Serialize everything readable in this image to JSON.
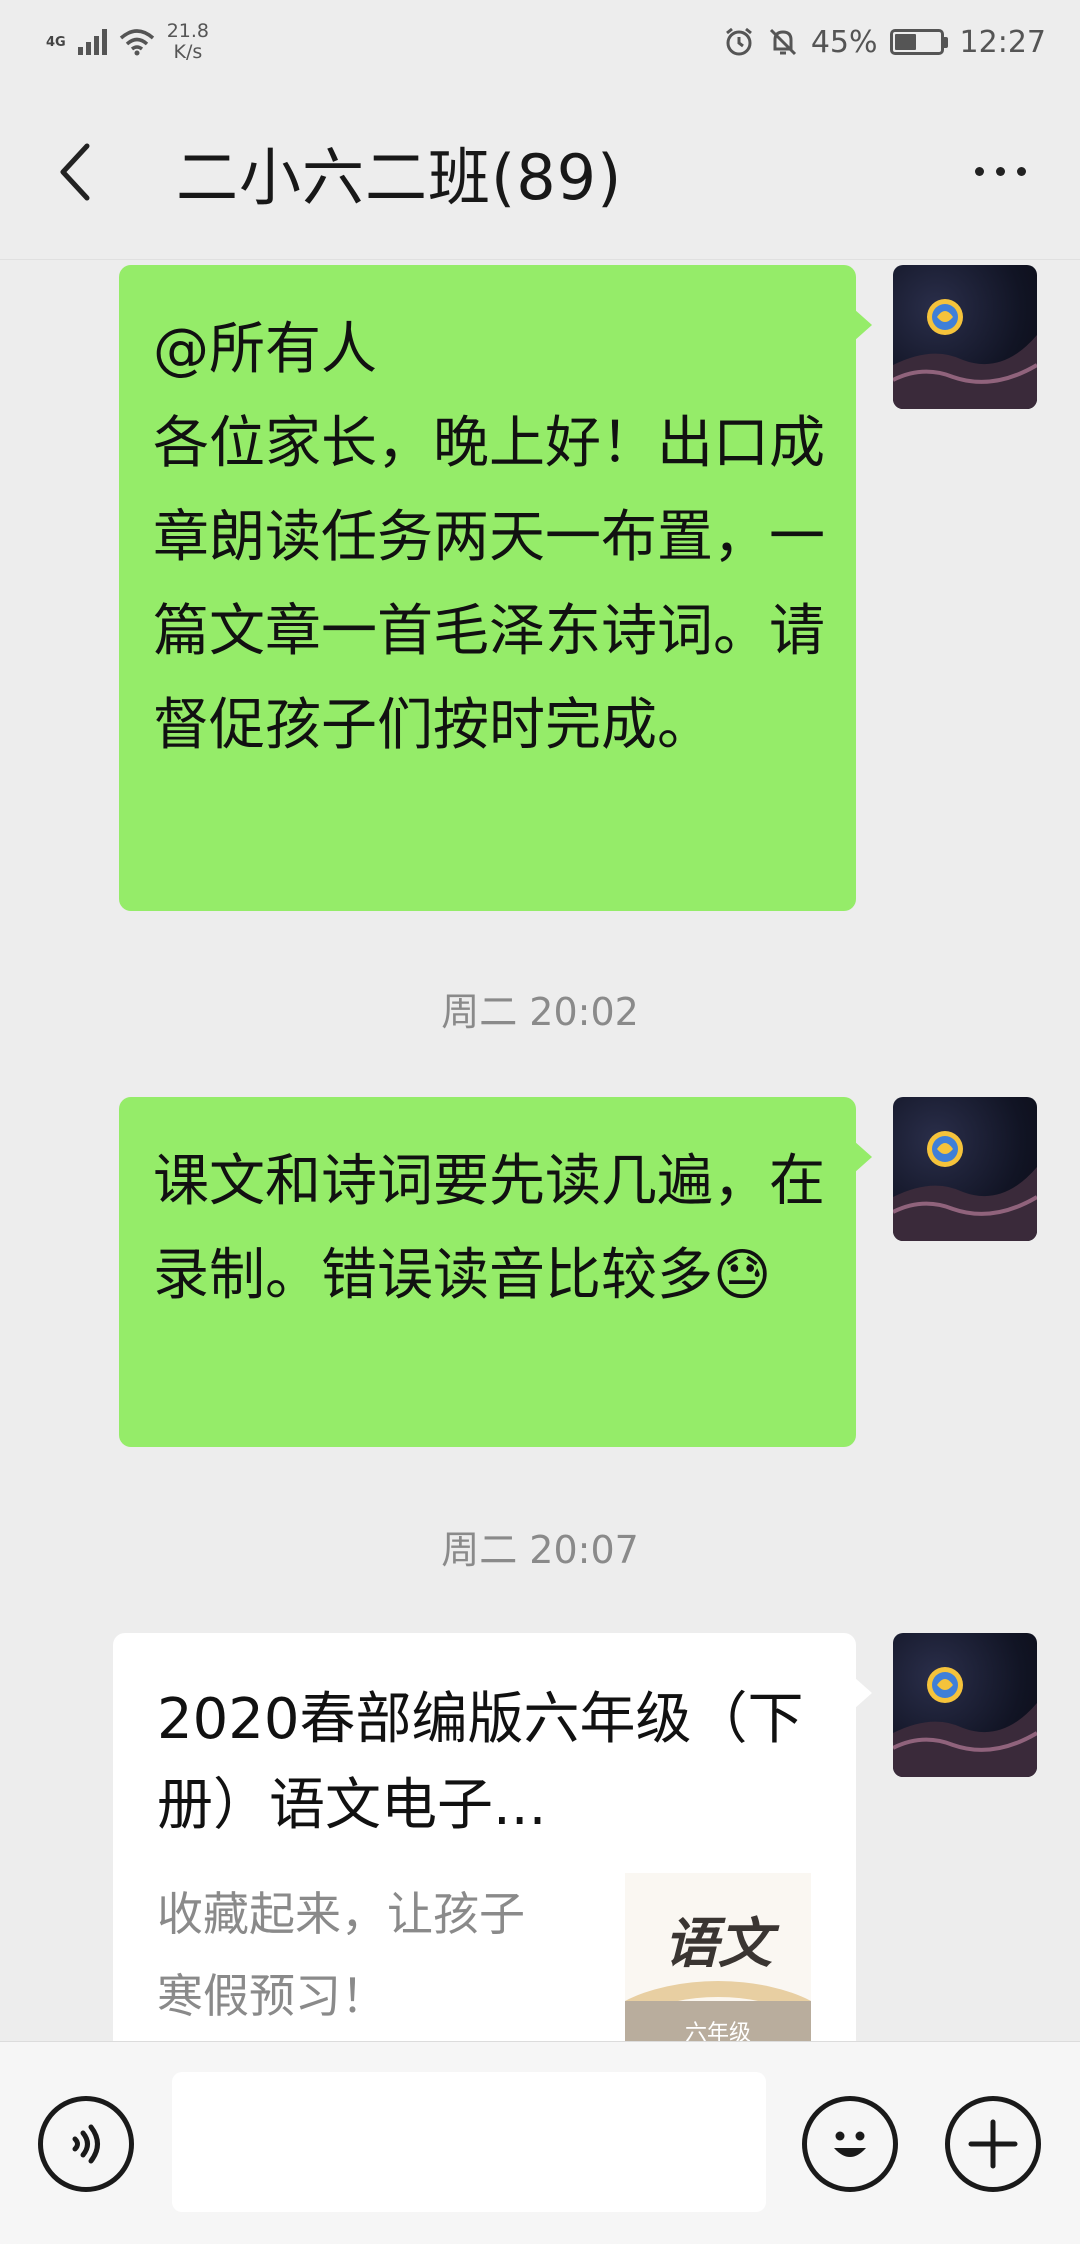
{
  "status_bar": {
    "network": "4G",
    "speed_value": "21.8",
    "speed_unit": "K/s",
    "battery": "45%",
    "time": "12:27"
  },
  "header": {
    "title": "二小六二班(89)",
    "back_icon": "chevron-left-icon",
    "more_icon": "more-horizontal-icon"
  },
  "messages": [
    {
      "type": "text",
      "text": "@所有人\n各位家长，晚上好！出口成章朗读任务两天一布置，一篇文章一首毛泽东诗词。请督促孩子们按时完成。"
    },
    {
      "type": "timestamp",
      "text": "周二 20:02"
    },
    {
      "type": "text",
      "text": "课文和诗词要先读几遍，在录制。错误读音比较多",
      "emoji": "😓"
    },
    {
      "type": "timestamp",
      "text": "周二 20:07"
    },
    {
      "type": "link_card",
      "title": "2020春部编版六年级（下册）语文电子...",
      "description": "收藏起来，让孩子寒假预习！",
      "thumb_main": "语文",
      "thumb_grade": "六年级"
    }
  ],
  "colors": {
    "background": "#ededed",
    "bubble_green": "#95ec69",
    "timestamp_gray": "#8a8a8a"
  },
  "input_bar": {
    "voice_icon": "voice-icon",
    "emoji_icon": "emoji-icon",
    "add_icon": "plus-icon",
    "input_value": ""
  }
}
